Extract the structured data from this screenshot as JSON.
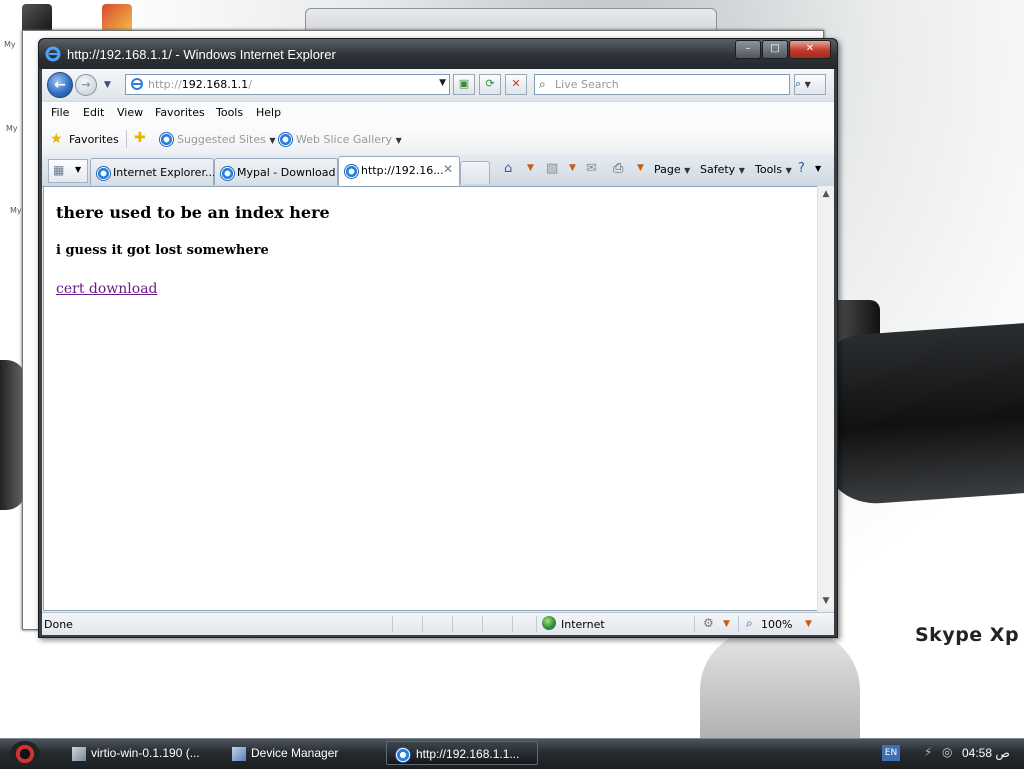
{
  "window": {
    "title": "http://192.168.1.1/ - Windows Internet Explorer",
    "minimize": "–",
    "maximize": "□",
    "close": "✕"
  },
  "nav": {
    "address_protocol": "http://",
    "address_host": "192.168.1.1",
    "address_trail": "/",
    "search_placeholder": "Live Search"
  },
  "menu": [
    "File",
    "Edit",
    "View",
    "Favorites",
    "Tools",
    "Help"
  ],
  "favorites_bar": {
    "favorites_label": "Favorites",
    "suggested_sites": "Suggested Sites",
    "web_slice_gallery": "Web Slice Gallery"
  },
  "tabs": [
    {
      "label": "Internet Explorer..."
    },
    {
      "label": "Mypal - Download"
    },
    {
      "label": "http://192.16..."
    }
  ],
  "commands": {
    "page": "Page",
    "safety": "Safety",
    "tools": "Tools"
  },
  "content": {
    "heading": "there used to be an index here",
    "subheading": "i guess it got lost somewhere",
    "link": "cert download"
  },
  "status": {
    "text": "Done",
    "zone": "Internet",
    "zoom": "100%"
  },
  "desktop": {
    "watermark": "Skype Xp"
  },
  "taskbar": {
    "items": [
      {
        "label": "virtio-win-0.1.190 (..."
      },
      {
        "label": "Device Manager"
      },
      {
        "label": "http://192.168.1.1..."
      }
    ],
    "language": "EN",
    "clock": "ص 04:58"
  },
  "colors": {
    "link_visited": "#6b1a8b",
    "title_bar": "#2d3237",
    "taskbar": "#262b30"
  }
}
